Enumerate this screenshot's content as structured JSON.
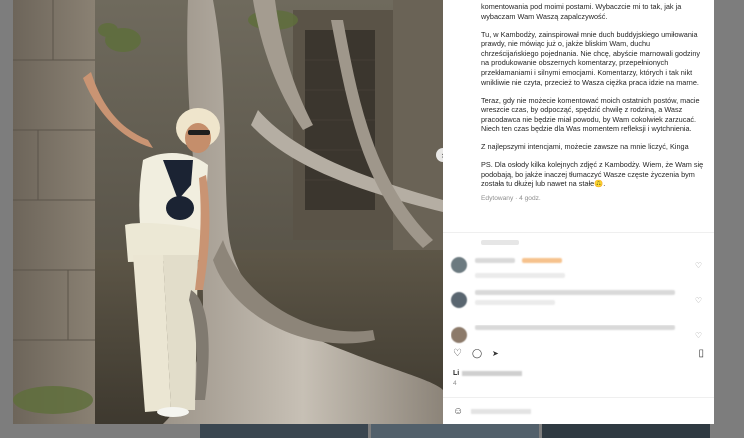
{
  "post": {
    "caption": [
      "komentowania pod moimi postami. Wybaczcie mi to tak, jak ja wybaczam Wam Waszą zapalczywość.",
      "Tu, w Kambodży, zainspirował mnie duch buddyjskiego umiłowania prawdy, nie mówiąc już o, jakże bliskim Wam, duchu chrześcijańskiego pojednania. Nie chcę, abyście marnowali godziny na produkowanie obszernych komentarzy, przepełnionych przekłamaniami i silnymi emocjami. Komentarzy, których i tak nikt wnikliwie nie czyta, przecież to Wasza ciężka praca idzie na marne.",
      "Teraz, gdy nie możecie komentować moich ostatnich postów, macie wreszcie czas, by odpocząć, spędzić chwilę z rodziną, a Wasz pracodawca nie będzie miał powodu, by Wam cokolwiek zarzucać. Niech ten czas będzie dla Was momentem refleksji i wytchnienia.",
      "Z najlepszymi intencjami, możecie zawsze na mnie liczyć, Kinga",
      "PS. Dla osłody kilka kolejnych zdjęć z Kambodży. Wiem, że Wam się podobają, bo jakże inaczej tłumaczyć Wasze częste życzenia bym została tu dłużej lub nawet na stałe🙃."
    ],
    "meta": "Edytowany · 4 godz.",
    "likes_prefix": "Li",
    "time_prefix": "4"
  },
  "icons": {
    "next": "chevron-right-icon",
    "heart": "heart-icon",
    "comment": "comment-icon",
    "share": "share-icon",
    "save": "bookmark-icon",
    "emoji": "emoji-icon"
  },
  "glyphs": {
    "next": "›",
    "heart": "♡",
    "comment": "◯",
    "share": "➤",
    "save": "▯",
    "emoji": "☺"
  }
}
